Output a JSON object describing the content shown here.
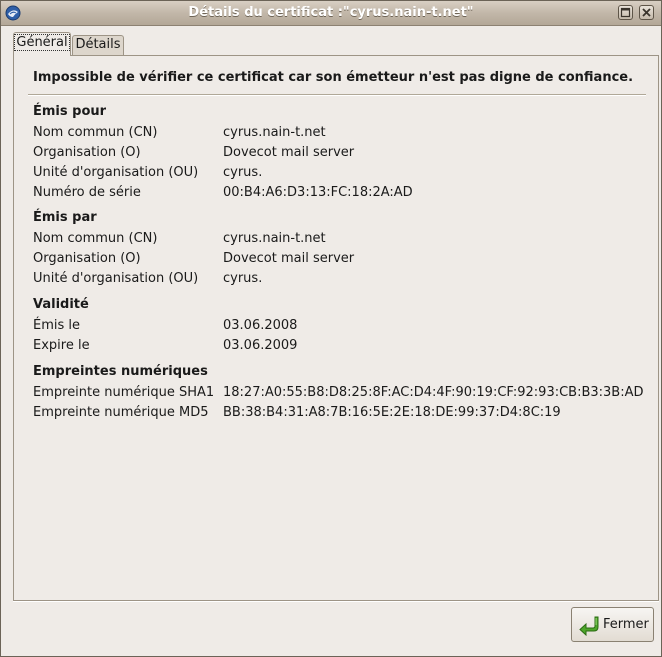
{
  "window": {
    "title": "Détails du certificat :\"cyrus.nain-t.net\""
  },
  "tabs": [
    {
      "label": "Général"
    },
    {
      "label": "Détails"
    }
  ],
  "warning": "Impossible de vérifier ce certificat car son émetteur n'est pas digne de confiance.",
  "issued_to": {
    "title": "Émis pour",
    "rows": [
      {
        "label": "Nom commun (CN)",
        "value": "cyrus.nain-t.net"
      },
      {
        "label": "Organisation (O)",
        "value": "Dovecot mail server"
      },
      {
        "label": "Unité d'organisation (OU)",
        "value": "cyrus."
      },
      {
        "label": "Numéro de série",
        "value": "00:B4:A6:D3:13:FC:18:2A:AD"
      }
    ]
  },
  "issued_by": {
    "title": "Émis par",
    "rows": [
      {
        "label": "Nom commun (CN)",
        "value": "cyrus.nain-t.net"
      },
      {
        "label": "Organisation (O)",
        "value": "Dovecot mail server"
      },
      {
        "label": "Unité d'organisation (OU)",
        "value": "cyrus."
      }
    ]
  },
  "validity": {
    "title": "Validité",
    "rows": [
      {
        "label": "Émis le",
        "value": "03.06.2008"
      },
      {
        "label": "Expire le",
        "value": "03.06.2009"
      }
    ]
  },
  "fingerprints": {
    "title": "Empreintes numériques",
    "rows": [
      {
        "label": "Empreinte numérique SHA1",
        "value": "18:27:A0:55:B8:D8:25:8F:AC:D4:4F:90:19:CF:92:93:CB:B3:3B:AD"
      },
      {
        "label": "Empreinte numérique MD5",
        "value": "BB:38:B4:31:A8:7B:16:5E:2E:18:DE:99:37:D4:8C:19"
      }
    ]
  },
  "buttons": {
    "close": "Fermer"
  },
  "icons": {
    "app": "thunderbird-icon",
    "maximize": "maximize-icon",
    "close": "close-icon",
    "close_button": "return-arrow-icon"
  },
  "colors": {
    "background": "#efebe7",
    "titlebar": "#c2b7a9",
    "accent_green": "#3d9a1f"
  }
}
